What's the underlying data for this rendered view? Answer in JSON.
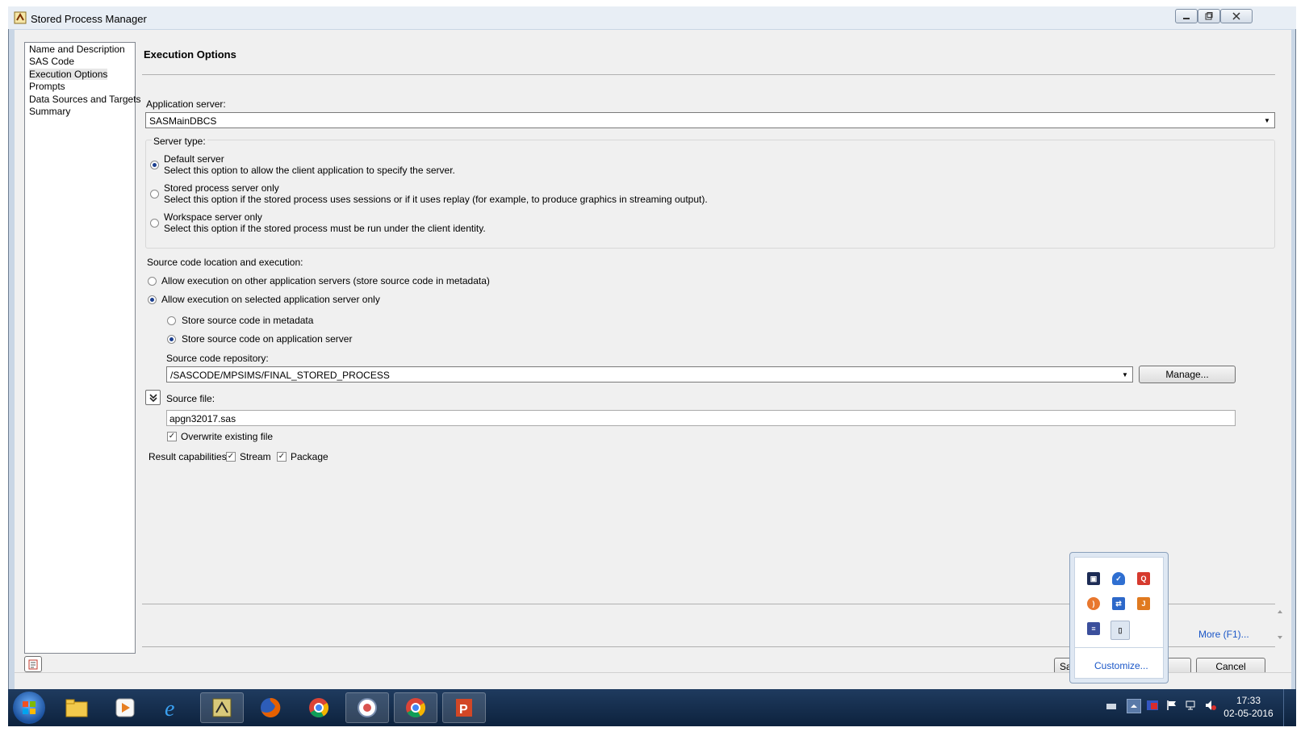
{
  "window": {
    "title": "Stored Process Manager"
  },
  "nav": {
    "items": [
      {
        "label": "Name and Description"
      },
      {
        "label": "SAS Code"
      },
      {
        "label": "Execution Options"
      },
      {
        "label": "Prompts"
      },
      {
        "label": "Data Sources and Targets"
      },
      {
        "label": "Summary"
      }
    ],
    "selected": "Execution Options"
  },
  "main": {
    "heading": "Execution Options",
    "app_server_label": "Application server:",
    "app_server_value": "SASMainDBCS",
    "server_type": {
      "legend": "Server type:",
      "options": [
        {
          "label": "Default server",
          "desc": "Select this option to allow the client application to specify the server.",
          "selected": true
        },
        {
          "label": "Stored process server only",
          "desc": "Select this option if the stored process uses sessions or if it uses replay (for example, to produce graphics in streaming output).",
          "selected": false
        },
        {
          "label": "Workspace server only",
          "desc": "Select this option if the stored process must be run under the client identity.",
          "selected": false
        }
      ]
    },
    "source_location": {
      "label": "Source code location and execution:",
      "option_other": "Allow execution on other application servers (store source code in metadata)",
      "option_selected_only": "Allow execution on selected application server only",
      "sub_metadata": "Store source code in metadata",
      "sub_app_server": "Store source code on application server"
    },
    "repository": {
      "label": "Source code repository:",
      "value": "/SASCODE/MPSIMS/FINAL_STORED_PROCESS",
      "manage_button": "Manage..."
    },
    "source_file": {
      "label": "Source file:",
      "value": "apgn32017.sas",
      "overwrite_label": "Overwrite existing file"
    },
    "result_capabilities": {
      "label": "Result capabilities:",
      "stream": "Stream",
      "package": "Package"
    },
    "more_link": "More (F1)..."
  },
  "footer": {
    "save_partial": "Sa",
    "cancel": "Cancel"
  },
  "tray_popup": {
    "customize": "Customize..."
  },
  "taskbar": {
    "time": "17:33",
    "date": "02-05-2016"
  }
}
